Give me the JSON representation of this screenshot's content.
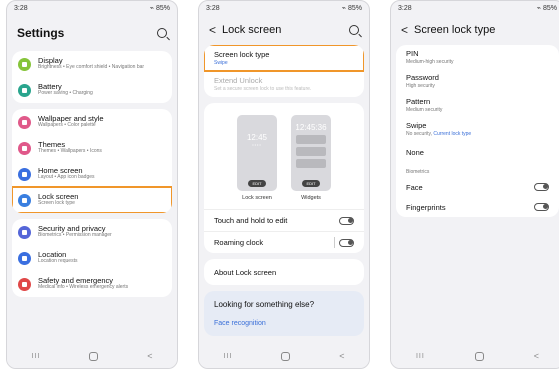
{
  "status": {
    "time": "3:28",
    "battery": "85%"
  },
  "settings": {
    "title": "Settings",
    "groups": [
      [
        {
          "title": "Display",
          "sub": "Brightness • Eye comfort shield • Navigation bar",
          "color": "#86c43a"
        },
        {
          "title": "Battery",
          "sub": "Power saving • Charging",
          "color": "#2aa58e"
        }
      ],
      [
        {
          "title": "Wallpaper and style",
          "sub": "Wallpapers • Color palette",
          "color": "#e05a8a"
        },
        {
          "title": "Themes",
          "sub": "Themes • Wallpapers • Icons",
          "color": "#e0588a"
        },
        {
          "title": "Home screen",
          "sub": "Layout • App icon badges",
          "color": "#3a6fe0"
        },
        {
          "title": "Lock screen",
          "sub": "Screen lock type",
          "color": "#3a7fe0"
        }
      ],
      [
        {
          "title": "Security and privacy",
          "sub": "Biometrics • Permission manager",
          "color": "#5566d8"
        },
        {
          "title": "Location",
          "sub": "Location requests",
          "color": "#3a6fe0"
        },
        {
          "title": "Safety and emergency",
          "sub": "Medical info • Wireless emergency alerts",
          "color": "#e04848"
        }
      ]
    ]
  },
  "lock": {
    "title": "Lock screen",
    "screen_lock_type": "Screen lock type",
    "screen_lock_value": "Swipe",
    "extend_unlock": "Extend Unlock",
    "extend_unlock_sub": "Set a secure screen lock to use this feature.",
    "preview_time_1": "12:45",
    "preview_time_2": "12:45:36",
    "preview_dots": "••••",
    "edit": "EDIT",
    "lock_label": "Lock screen",
    "widgets_label": "Widgets",
    "touch_hold": "Touch and hold to edit",
    "roaming": "Roaming clock",
    "about": "About Lock screen",
    "looking": "Looking for something else?",
    "face_recognition": "Face recognition"
  },
  "type": {
    "title": "Screen lock type",
    "items": [
      {
        "title": "PIN",
        "sub": "Medium-high security"
      },
      {
        "title": "Password",
        "sub": "High security"
      },
      {
        "title": "Pattern",
        "sub": "Medium security"
      },
      {
        "title": "Swipe",
        "sub": "No security,",
        "sub_current": "Current lock type"
      },
      {
        "title": "None",
        "sub": ""
      }
    ],
    "biometrics": "Biometrics",
    "face": "Face",
    "fingerprints": "Fingerprints"
  },
  "nav": {
    "recent": "III",
    "back": "<"
  }
}
